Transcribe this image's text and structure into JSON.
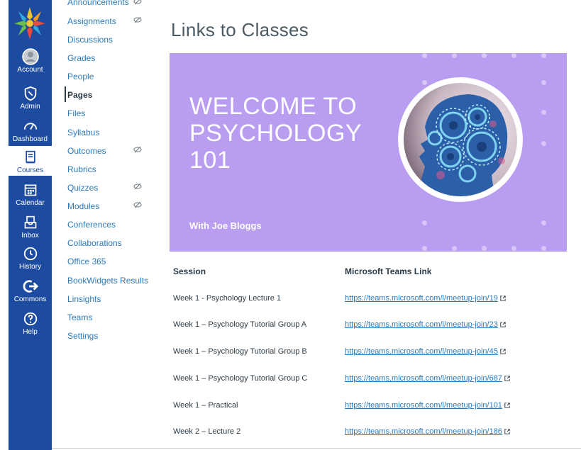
{
  "global_nav": {
    "items": [
      {
        "label": "Account",
        "icon": "account-icon"
      },
      {
        "label": "Admin",
        "icon": "admin-shield-icon"
      },
      {
        "label": "Dashboard",
        "icon": "dashboard-gauge-icon"
      },
      {
        "label": "Courses",
        "icon": "courses-book-icon",
        "active": true
      },
      {
        "label": "Calendar",
        "icon": "calendar-icon"
      },
      {
        "label": "Inbox",
        "icon": "inbox-icon"
      },
      {
        "label": "History",
        "icon": "history-clock-icon"
      },
      {
        "label": "Commons",
        "icon": "commons-arrow-icon"
      },
      {
        "label": "Help",
        "icon": "help-question-icon"
      }
    ],
    "colors": {
      "background": "#1d4ba0",
      "text": "#ffffff"
    }
  },
  "course_nav": {
    "items": [
      {
        "label": "Announcements",
        "hidden": true
      },
      {
        "label": "Assignments",
        "hidden": true
      },
      {
        "label": "Discussions"
      },
      {
        "label": "Grades"
      },
      {
        "label": "People"
      },
      {
        "label": "Pages",
        "active": true
      },
      {
        "label": "Files"
      },
      {
        "label": "Syllabus"
      },
      {
        "label": "Outcomes",
        "hidden": true
      },
      {
        "label": "Rubrics"
      },
      {
        "label": "Quizzes",
        "hidden": true
      },
      {
        "label": "Modules",
        "hidden": true
      },
      {
        "label": "Conferences"
      },
      {
        "label": "Collaborations"
      },
      {
        "label": "Office 365"
      },
      {
        "label": "BookWidgets Results"
      },
      {
        "label": "Linsights"
      },
      {
        "label": "Teams"
      },
      {
        "label": "Settings"
      }
    ],
    "link_color": "#2b7abc"
  },
  "page": {
    "title": "Links to Classes",
    "banner": {
      "title_line1": "WELCOME TO",
      "title_line2": "PSYCHOLOGY",
      "title_line3": "101",
      "subtitle": "With Joe Bloggs",
      "background": "#b89df0",
      "image_icon": "brain-gears-image"
    },
    "table": {
      "headers": [
        "Session",
        "Microsoft Teams Link"
      ],
      "rows": [
        {
          "session": "Week 1 - Psychology Lecture 1",
          "link": "https://teams.microsoft.com/l/meetup-join/19"
        },
        {
          "session": "Week 1 – Psychology Tutorial Group A",
          "link": "https://teams.microsoft.com/l/meetup-join/23"
        },
        {
          "session": "Week 1 – Psychology Tutorial Group B",
          "link": "https://teams.microsoft.com/l/meetup-join/45"
        },
        {
          "session": "Week 1 – Psychology Tutorial Group C",
          "link": "https://teams.microsoft.com/l/meetup-join/687"
        },
        {
          "session": "Week 1 – Practical",
          "link": "https://teams.microsoft.com/l/meetup-join/101"
        },
        {
          "session": "Week 2 – Lecture 2",
          "link": "https://teams.microsoft.com/l/meetup-join/186"
        }
      ],
      "external_icon": "external-link-icon"
    }
  }
}
